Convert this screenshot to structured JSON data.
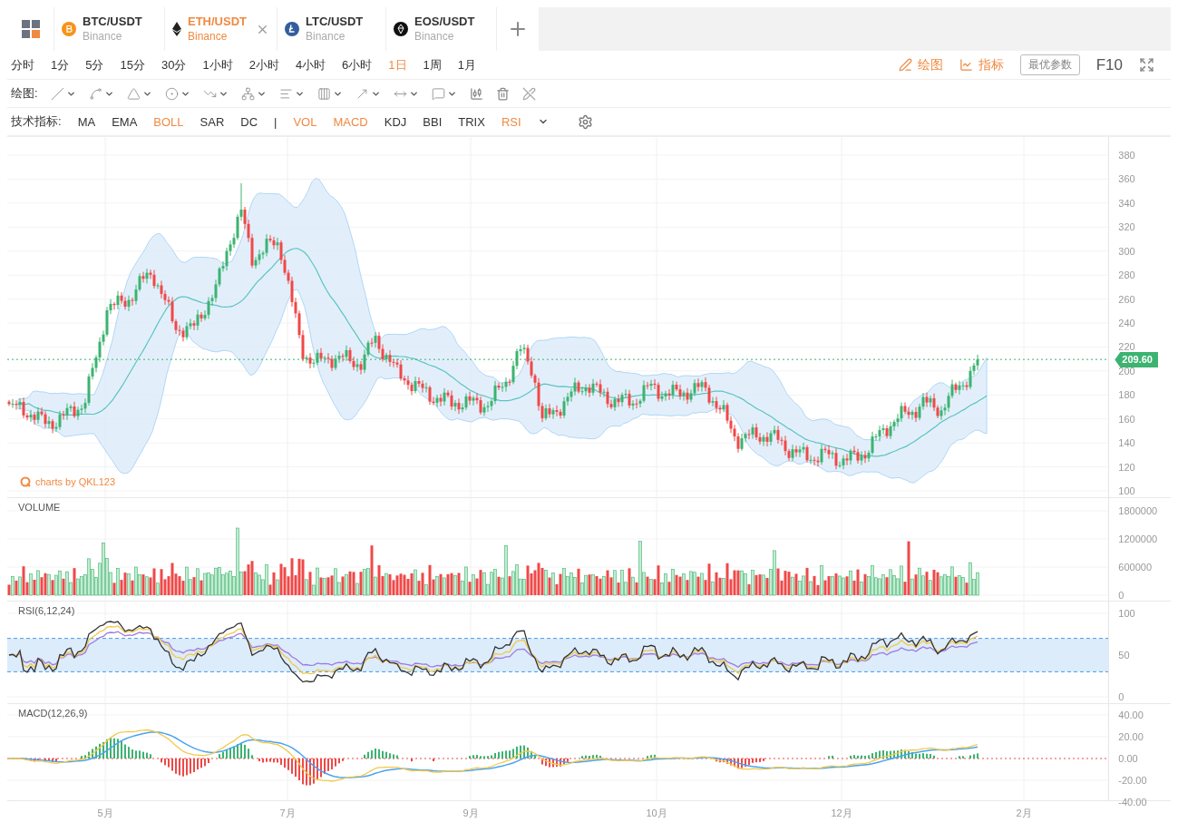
{
  "tabs": [
    {
      "kind": "btc",
      "pair": "BTC/USDT",
      "exchange": "Binance",
      "selected": false
    },
    {
      "kind": "eth",
      "pair": "ETH/USDT",
      "exchange": "Binance",
      "selected": true
    },
    {
      "kind": "ltc",
      "pair": "LTC/USDT",
      "exchange": "Binance",
      "selected": false
    },
    {
      "kind": "eos",
      "pair": "EOS/USDT",
      "exchange": "Binance",
      "selected": false
    }
  ],
  "periods": [
    {
      "label": "分时",
      "selected": false
    },
    {
      "label": "1分",
      "selected": false
    },
    {
      "label": "5分",
      "selected": false
    },
    {
      "label": "15分",
      "selected": false
    },
    {
      "label": "30分",
      "selected": false
    },
    {
      "label": "1小时",
      "selected": false
    },
    {
      "label": "2小时",
      "selected": false
    },
    {
      "label": "4小时",
      "selected": false
    },
    {
      "label": "6小时",
      "selected": false
    },
    {
      "label": "1日",
      "selected": true
    },
    {
      "label": "1周",
      "selected": false
    },
    {
      "label": "1月",
      "selected": false
    }
  ],
  "toolbar_right": {
    "draw": "绘图",
    "indicators": "指标",
    "best_params": "最优参数",
    "f10": "F10"
  },
  "drawing_tools": {
    "label": "绘图:"
  },
  "indicators": {
    "label": "技术指标:",
    "main": [
      {
        "label": "MA",
        "on": false
      },
      {
        "label": "EMA",
        "on": false
      },
      {
        "label": "BOLL",
        "on": true
      },
      {
        "label": "SAR",
        "on": false
      },
      {
        "label": "DC",
        "on": false
      }
    ],
    "separator": "|",
    "sub": [
      {
        "label": "VOL",
        "on": true
      },
      {
        "label": "MACD",
        "on": true
      },
      {
        "label": "KDJ",
        "on": false
      },
      {
        "label": "BBI",
        "on": false
      },
      {
        "label": "TRIX",
        "on": false
      },
      {
        "label": "RSI",
        "on": true
      }
    ]
  },
  "price_pane": {
    "ticks": [
      "380",
      "360",
      "340",
      "320",
      "300",
      "280",
      "260",
      "240",
      "220",
      "200",
      "180",
      "160",
      "140",
      "120",
      "100"
    ],
    "last_price": "209.60",
    "watermark": "charts by QKL123"
  },
  "volume_pane": {
    "title": "VOLUME",
    "ticks": [
      "1800000",
      "1200000",
      "600000",
      "0"
    ]
  },
  "rsi_pane": {
    "title": "RSI(6,12,24)",
    "ticks": [
      "100",
      "50",
      "0"
    ]
  },
  "macd_pane": {
    "title": "MACD(12,26,9)",
    "ticks": [
      "40.00",
      "20.00",
      "0.00",
      "-20.00",
      "-40.00"
    ]
  },
  "x_axis": [
    "5月",
    "7月",
    "9月",
    "10月",
    "12月",
    "2月"
  ]
}
